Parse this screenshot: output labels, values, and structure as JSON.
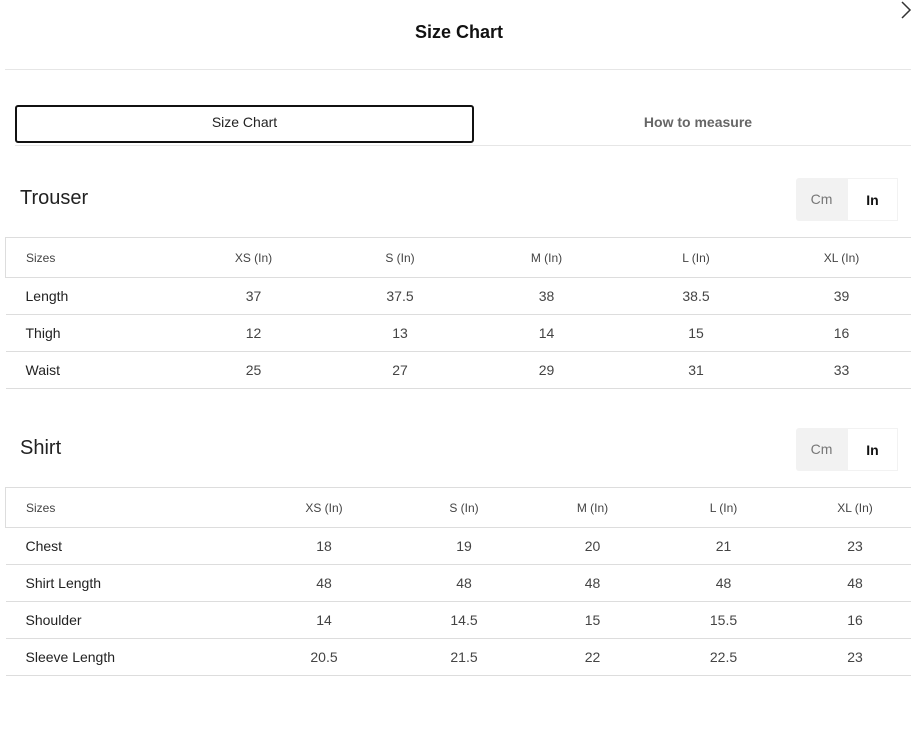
{
  "modal": {
    "title": "Size Chart",
    "close_icon": "close-icon"
  },
  "tabs": [
    {
      "label": "Size Chart",
      "active": true
    },
    {
      "label": "How to measure",
      "active": false
    }
  ],
  "sections": [
    {
      "title": "Trouser",
      "units": {
        "cm": "Cm",
        "in": "In",
        "selected": "In"
      },
      "headers": [
        "Sizes",
        "XS (In)",
        "S (In)",
        "M (In)",
        "L (In)",
        "XL (In)"
      ],
      "rows": [
        [
          "Length",
          "37",
          "37.5",
          "38",
          "38.5",
          "39"
        ],
        [
          "Thigh",
          "12",
          "13",
          "14",
          "15",
          "16"
        ],
        [
          "Waist",
          "25",
          "27",
          "29",
          "31",
          "33"
        ]
      ]
    },
    {
      "title": "Shirt",
      "units": {
        "cm": "Cm",
        "in": "In",
        "selected": "In"
      },
      "headers": [
        "Sizes",
        "XS (In)",
        "S (In)",
        "M (In)",
        "L (In)",
        "XL (In)"
      ],
      "rows": [
        [
          "Chest",
          "18",
          "19",
          "20",
          "21",
          "23"
        ],
        [
          "Shirt Length",
          "48",
          "48",
          "48",
          "48",
          "48"
        ],
        [
          "Shoulder",
          "14",
          "14.5",
          "15",
          "15.5",
          "16"
        ],
        [
          "Sleeve Length",
          "20.5",
          "21.5",
          "22",
          "22.5",
          "23"
        ]
      ]
    }
  ]
}
